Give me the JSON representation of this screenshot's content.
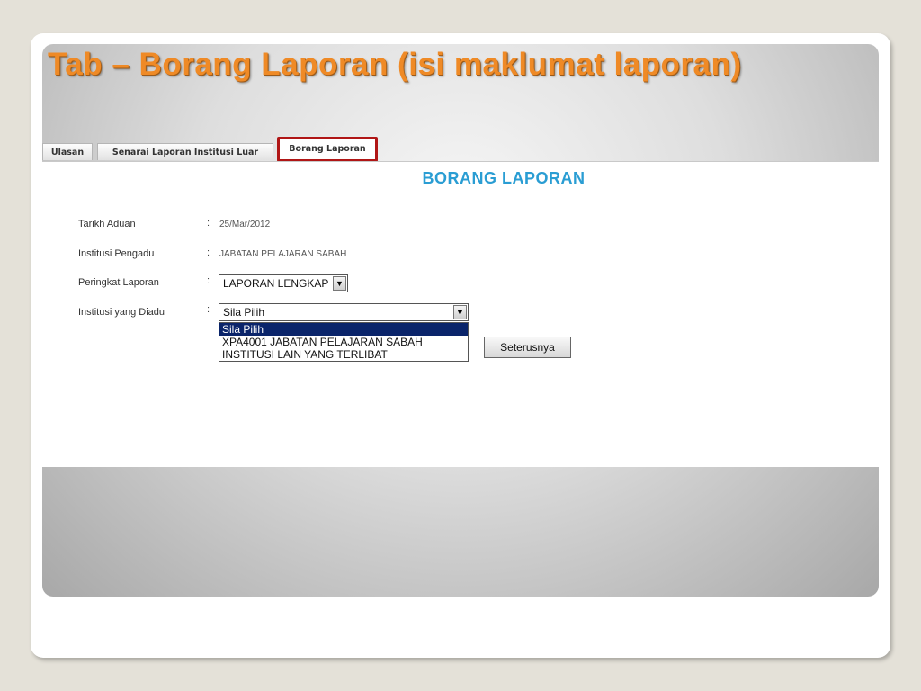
{
  "slide": {
    "title": "Tab – Borang Laporan (isi maklumat laporan)"
  },
  "tabs": [
    {
      "label": "Ulasan"
    },
    {
      "label": "Senarai Laporan Institusi Luar"
    },
    {
      "label": "Borang Laporan",
      "active": true,
      "highlight_color": "#b01616"
    }
  ],
  "form": {
    "heading": "BORANG LAPORAN",
    "colon": ":",
    "fields": [
      {
        "label": "Tarikh Aduan",
        "value": "25/Mar/2012"
      },
      {
        "label": "Institusi Pengadu",
        "value": "JABATAN PELAJARAN SABAH"
      },
      {
        "label": "Peringkat Laporan",
        "value": "LAPORAN LENGKAP"
      },
      {
        "label": "Institusi yang Diadu",
        "value": "Sila Pilih"
      }
    ],
    "dropdown_options": [
      {
        "label": "Sila Pilih",
        "selected": true
      },
      {
        "label": "XPA4001 JABATAN PELAJARAN SABAH"
      },
      {
        "label": "INSTITUSI LAIN YANG TERLIBAT"
      }
    ],
    "next_button": "Seterusnya",
    "arrow_glyph": "▼"
  },
  "colors": {
    "title": "#ef8a26",
    "heading": "#2a9dd3",
    "selected_option_bg": "#0a246a",
    "tab_highlight": "#b01616"
  }
}
